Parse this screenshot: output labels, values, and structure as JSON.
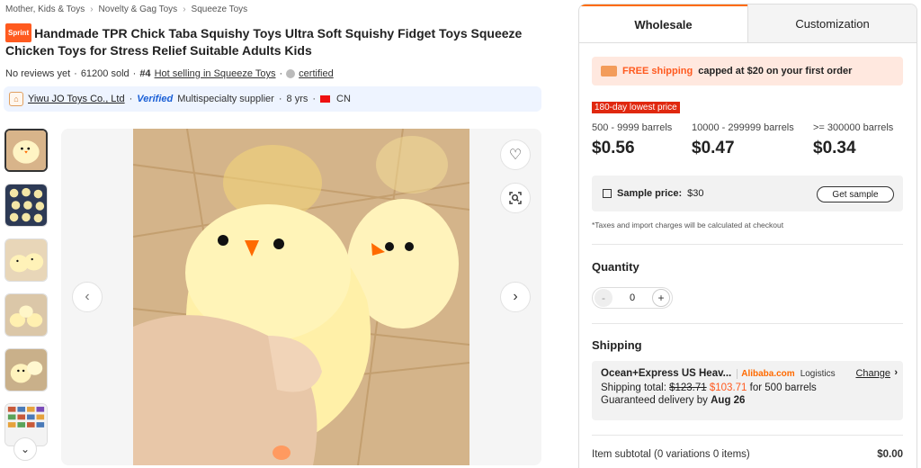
{
  "breadcrumb": [
    "Mother, Kids & Toys",
    "Novelty & Gag Toys",
    "Squeeze Toys"
  ],
  "product": {
    "badge": "Sprint",
    "title": "Handmade TPR Chick Taba Squishy Toys Ultra Soft Squishy Fidget Toys Squeeze Chicken Toys for Stress Relief Suitable Adults Kids",
    "reviews": "No reviews yet",
    "sold": "61200 sold",
    "rank": "#4",
    "rank_category": "Hot selling in Squeeze Toys",
    "certified": "certified"
  },
  "supplier": {
    "name": "Yiwu JO Toys Co., Ltd",
    "verified": "Verified",
    "type": "Multispecialty supplier",
    "years": "8 yrs",
    "country": "CN"
  },
  "gallery": {
    "thumb_count": 6,
    "colors": {
      "image_bg": "#d9b98f",
      "chick": "#fff4b8",
      "beak": "#ff6a00"
    }
  },
  "tabs": [
    {
      "label": "Wholesale"
    },
    {
      "label": "Customization"
    }
  ],
  "shipping_banner": {
    "highlight": "FREE shipping",
    "rest": "capped at $20 on your first order"
  },
  "pricing": {
    "lowest_label": "180-day lowest price",
    "tiers": [
      {
        "range": "500 - 9999 barrels",
        "price": "$0.56"
      },
      {
        "range": "10000 - 299999 barrels",
        "price": "$0.47"
      },
      {
        "range": ">= 300000 barrels",
        "price": "$0.34"
      }
    ]
  },
  "sample": {
    "label": "Sample price:",
    "price": "$30",
    "button": "Get sample"
  },
  "tax_note": "*Taxes and import charges will be calculated at checkout",
  "quantity": {
    "title": "Quantity",
    "value": "0",
    "minus": "-",
    "plus": "+"
  },
  "shipping": {
    "title": "Shipping",
    "method": "Ocean+Express US Heav...",
    "carrier_brand": "Alibaba.com",
    "carrier_suffix": "Logistics",
    "change": "Change",
    "total_label": "Shipping total:",
    "old_price": "$123.71",
    "new_price": "$103.71",
    "for_qty": "for 500 barrels",
    "guaranteed_label": "Guaranteed delivery by",
    "guaranteed_date": "Aug 26"
  },
  "subtotal": {
    "label": "Item subtotal (0 variations 0 items)",
    "amount": "$0.00"
  },
  "accent": "#ff6a00"
}
